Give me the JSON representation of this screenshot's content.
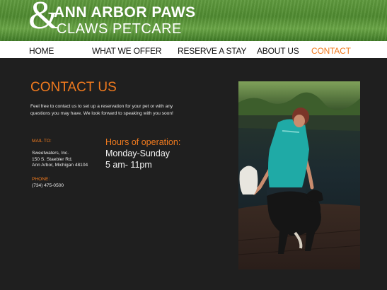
{
  "brand": {
    "ampersand": "&",
    "line1": "ANN ARBOR PAWS",
    "line2": "CLAWS PETCARE"
  },
  "nav": {
    "items": [
      "HOME",
      "WHAT WE OFFER",
      "RESERVE A STAY",
      "ABOUT US",
      "CONTACT"
    ],
    "active": "CONTACT"
  },
  "contact": {
    "title": "CONTACT US",
    "intro": "Feel free to contact us to set up a reservation for your pet or with any questions you may have. We look forward to speaking with you soon!",
    "mail_label": "MAIL TO:",
    "address": [
      "Sweetwaters, Inc.",
      "150 S. Staebler Rd.",
      "Ann Arbor, Michigan 48104"
    ],
    "phone_label": "PHONE:",
    "phone": "(734) 475-0500"
  },
  "hours": {
    "label": "Hours of operation:",
    "days": "Monday-Sunday",
    "time": "5 am- 11pm"
  },
  "colors": {
    "accent": "#f07a1e",
    "background": "#1f1f1f",
    "nav_bg": "#ffffff",
    "header_grass": "#5f9a3e"
  }
}
